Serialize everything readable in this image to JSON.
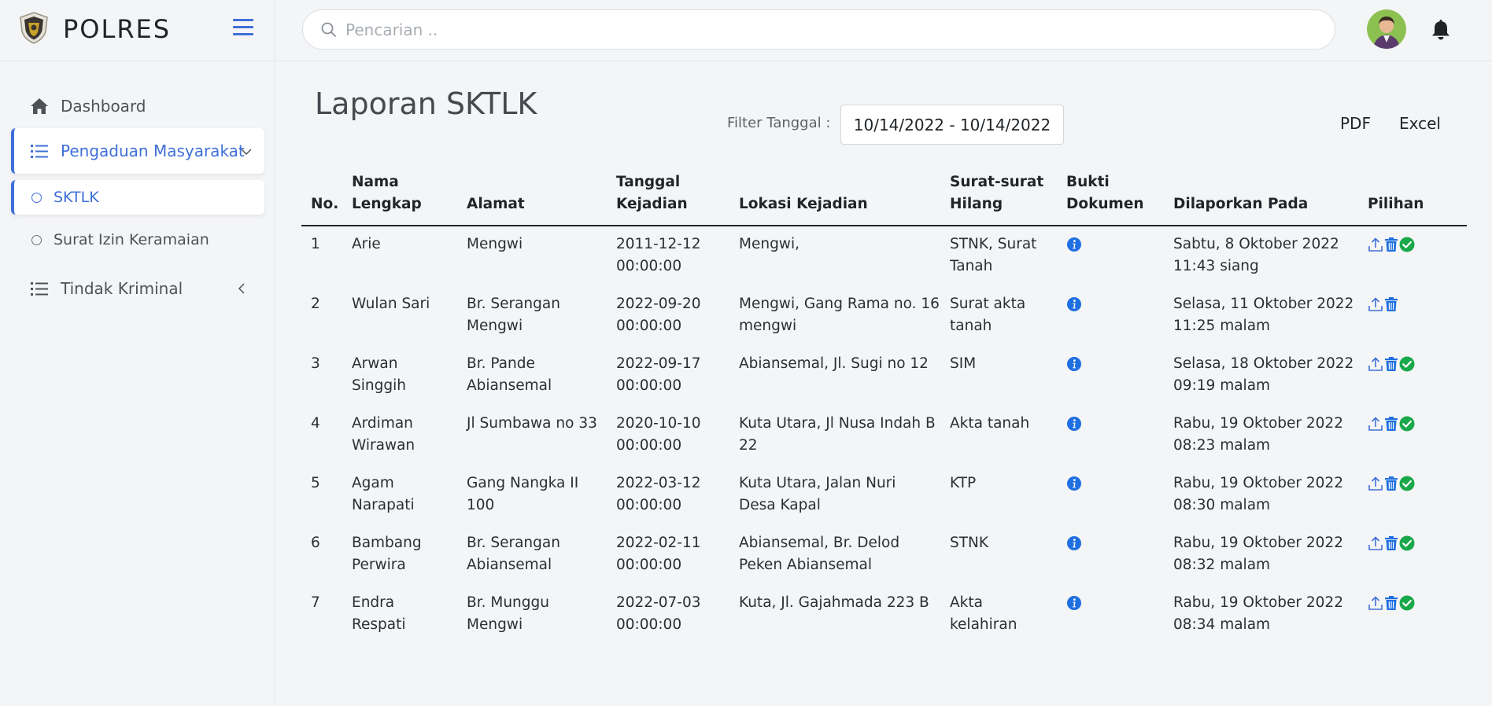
{
  "brand": {
    "name": "POLRES"
  },
  "search": {
    "placeholder": "Pencarian .."
  },
  "sidebar": {
    "dashboard": "Dashboard",
    "pengaduan": "Pengaduan Masyarakat",
    "sktlk": "SKTLK",
    "surat_izin": "Surat Izin Keramaian",
    "tindak_kriminal": "Tindak Kriminal"
  },
  "page": {
    "title": "Laporan SKTLK",
    "filter_label": "Filter Tanggal :",
    "filter_value": "10/14/2022 - 10/14/2022",
    "pdf": "PDF",
    "excel": "Excel"
  },
  "table": {
    "headers": {
      "no": "No.",
      "nama_1": "Nama",
      "nama_2": "Lengkap",
      "alamat": "Alamat",
      "tanggal_1": "Tanggal",
      "tanggal_2": "Kejadian",
      "lokasi": "Lokasi Kejadian",
      "surat_1": "Surat-surat",
      "surat_2": "Hilang",
      "bukti_1": "Bukti",
      "bukti_2": "Dokumen",
      "dilaporkan": "Dilaporkan Pada",
      "pilihan": "Pilihan"
    },
    "rows": [
      {
        "no": "1",
        "nama": [
          "Arie"
        ],
        "alamat": [
          "Mengwi"
        ],
        "tanggal": [
          "2011-12-12",
          "00:00:00"
        ],
        "lokasi": [
          "Mengwi,"
        ],
        "surat": [
          "STNK, Surat",
          "Tanah"
        ],
        "dilaporkan": [
          "Sabtu, 8 Oktober 2022",
          "11:43 siang"
        ],
        "approved": true
      },
      {
        "no": "2",
        "nama": [
          "Wulan Sari"
        ],
        "alamat": [
          "Br. Serangan",
          "Mengwi"
        ],
        "tanggal": [
          "2022-09-20",
          "00:00:00"
        ],
        "lokasi": [
          "Mengwi, Gang Rama no. 16",
          "mengwi"
        ],
        "surat": [
          "Surat akta",
          "tanah"
        ],
        "dilaporkan": [
          "Selasa, 11 Oktober 2022",
          "11:25 malam"
        ],
        "approved": false
      },
      {
        "no": "3",
        "nama": [
          "Arwan",
          "Singgih"
        ],
        "alamat": [
          "Br. Pande",
          "Abiansemal"
        ],
        "tanggal": [
          "2022-09-17",
          "00:00:00"
        ],
        "lokasi": [
          "Abiansemal, Jl. Sugi no 12"
        ],
        "surat": [
          "SIM"
        ],
        "dilaporkan": [
          "Selasa, 18 Oktober 2022",
          "09:19 malam"
        ],
        "approved": true
      },
      {
        "no": "4",
        "nama": [
          "Ardiman",
          "Wirawan"
        ],
        "alamat": [
          "Jl Sumbawa no 33"
        ],
        "tanggal": [
          "2020-10-10",
          "00:00:00"
        ],
        "lokasi": [
          "Kuta Utara, Jl Nusa Indah B",
          "22"
        ],
        "surat": [
          "Akta tanah"
        ],
        "dilaporkan": [
          "Rabu, 19 Oktober 2022",
          "08:23 malam"
        ],
        "approved": true
      },
      {
        "no": "5",
        "nama": [
          "Agam",
          "Narapati"
        ],
        "alamat": [
          "Gang Nangka II",
          "100"
        ],
        "tanggal": [
          "2022-03-12",
          "00:00:00"
        ],
        "lokasi": [
          "Kuta Utara, Jalan Nuri",
          "Desa Kapal"
        ],
        "surat": [
          "KTP"
        ],
        "dilaporkan": [
          "Rabu, 19 Oktober 2022",
          "08:30 malam"
        ],
        "approved": true
      },
      {
        "no": "6",
        "nama": [
          "Bambang",
          "Perwira"
        ],
        "alamat": [
          "Br. Serangan",
          "Abiansemal"
        ],
        "tanggal": [
          "2022-02-11",
          "00:00:00"
        ],
        "lokasi": [
          "Abiansemal, Br. Delod",
          "Peken Abiansemal"
        ],
        "surat": [
          "STNK"
        ],
        "dilaporkan": [
          "Rabu, 19 Oktober 2022",
          "08:32 malam"
        ],
        "approved": true
      },
      {
        "no": "7",
        "nama": [
          "Endra",
          "Respati"
        ],
        "alamat": [
          "Br. Munggu",
          "Mengwi"
        ],
        "tanggal": [
          "2022-07-03",
          "00:00:00"
        ],
        "lokasi": [
          "Kuta, Jl. Gajahmada 223 B"
        ],
        "surat": [
          "Akta",
          "kelahiran"
        ],
        "dilaporkan": [
          "Rabu, 19 Oktober 2022",
          "08:34 malam"
        ],
        "approved": true
      }
    ]
  },
  "colors": {
    "accent": "#3f6fd8",
    "info": "#1f6fe0",
    "success": "#19a84a"
  },
  "icons": [
    "shield-logo-icon",
    "menu-icon",
    "search-icon",
    "bell-icon",
    "home-icon",
    "list-icon",
    "chevron-down-icon",
    "chevron-left-icon",
    "info-icon",
    "upload-icon",
    "trash-icon",
    "check-circle-icon"
  ]
}
